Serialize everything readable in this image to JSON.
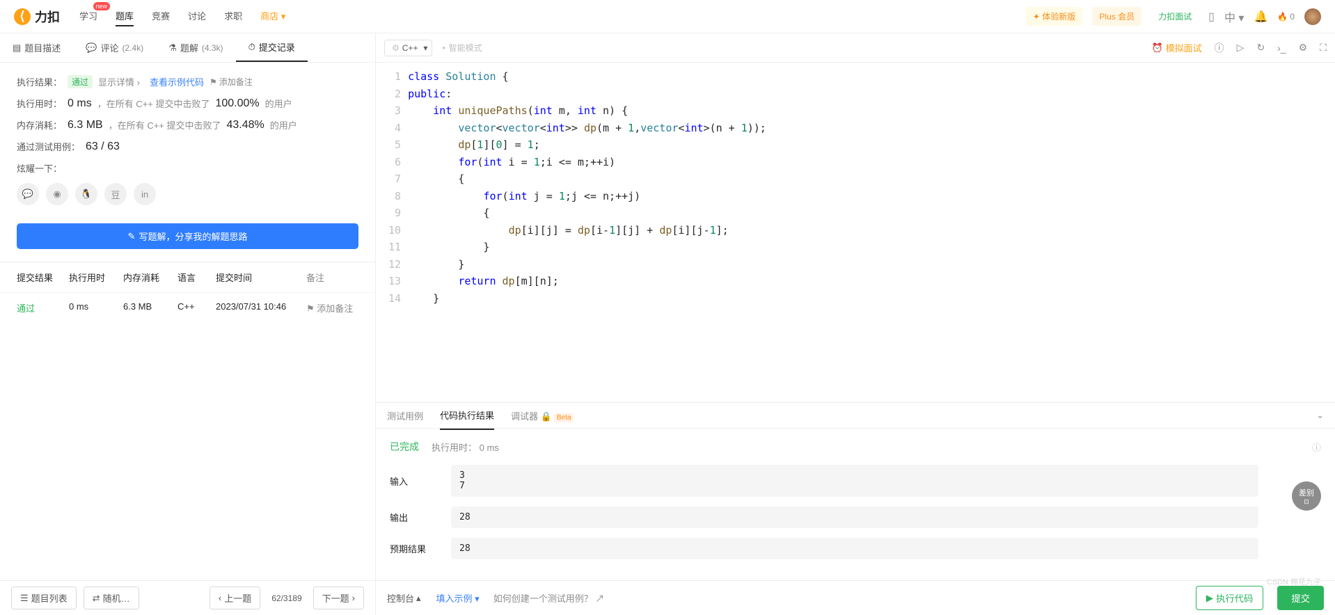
{
  "logo": "力扣",
  "nav": {
    "items": [
      "学习",
      "题库",
      "竞赛",
      "讨论",
      "求职",
      "商店"
    ],
    "badge_new": "new",
    "active_index": 1
  },
  "nav_right": {
    "try_new": "✦ 体验新版",
    "plus": "Plus 会员",
    "interview": "力扣面试",
    "lang": "中",
    "fire": "0"
  },
  "left_tabs": [
    {
      "icon": "▤",
      "label": "题目描述",
      "count": ""
    },
    {
      "icon": "💬",
      "label": "评论",
      "count": "(2.4k)"
    },
    {
      "icon": "⚗",
      "label": "题解",
      "count": "(4.3k)"
    },
    {
      "icon": "⏱",
      "label": "提交记录",
      "count": ""
    }
  ],
  "left_active_tab": 3,
  "result": {
    "exec_label": "执行结果：",
    "status": "通过",
    "show_detail": "显示详情",
    "view_example": "查看示例代码",
    "add_note": "添加备注",
    "runtime_label": "执行用时：",
    "runtime": "0 ms",
    "runtime_desc": "，在所有 C++ 提交中击败了",
    "runtime_pct": "100.00%",
    "runtime_users": "的用户",
    "memory_label": "内存消耗：",
    "memory": "6.3 MB",
    "memory_desc": "，在所有 C++ 提交中击败了",
    "memory_pct": "43.48%",
    "memory_users": "的用户",
    "testcase_label": "通过测试用例：",
    "testcase": "63 / 63",
    "share_label": "炫耀一下：",
    "write_solution": "写题解，分享我的解题思路"
  },
  "sub_table": {
    "headers": [
      "提交结果",
      "执行用时",
      "内存消耗",
      "语言",
      "提交时间",
      "备注"
    ],
    "rows": [
      {
        "result": "通过",
        "time": "0 ms",
        "mem": "6.3 MB",
        "lang": "C++",
        "date": "2023/07/31 10:46",
        "note": "添加备注"
      }
    ]
  },
  "code": {
    "lang": "C++",
    "smart_mode": "智能模式",
    "mock": "模拟面试"
  },
  "code_lines": [
    {
      "n": 1,
      "raw": "class Solution {"
    },
    {
      "n": 2,
      "raw": "public:"
    },
    {
      "n": 3,
      "raw": "    int uniquePaths(int m, int n) {"
    },
    {
      "n": 4,
      "raw": "        vector<vector<int>> dp(m + 1,vector<int>(n + 1));"
    },
    {
      "n": 5,
      "raw": "        dp[1][0] = 1;"
    },
    {
      "n": 6,
      "raw": "        for(int i = 1;i <= m;++i)"
    },
    {
      "n": 7,
      "raw": "        {"
    },
    {
      "n": 8,
      "raw": "            for(int j = 1;j <= n;++j)"
    },
    {
      "n": 9,
      "raw": "            {"
    },
    {
      "n": 10,
      "raw": "                dp[i][j] = dp[i-1][j] + dp[i][j-1];"
    },
    {
      "n": 11,
      "raw": "            }"
    },
    {
      "n": 12,
      "raw": "        }"
    },
    {
      "n": 13,
      "raw": "        return dp[m][n];"
    },
    {
      "n": 14,
      "raw": "    }"
    }
  ],
  "output_tabs": [
    "测试用例",
    "代码执行结果",
    "调试器"
  ],
  "output_active_tab": 1,
  "output": {
    "done": "已完成",
    "time_label": "执行用时：",
    "time": "0 ms",
    "input_label": "输入",
    "input": "3\n7",
    "output_label": "输出",
    "output_val": "28",
    "expected_label": "预期结果",
    "expected": "28",
    "beta": "Beta"
  },
  "bottom_left": {
    "list": "题目列表",
    "shuffle": "随机…",
    "prev": "上一题",
    "next": "下一题",
    "page": "62/3189"
  },
  "bottom_right": {
    "console": "控制台",
    "fill": "填入示例",
    "how": "如何创建一个测试用例？",
    "run": "执行代码",
    "submit": "提交"
  },
  "float_badge": "差别",
  "watermark": "CSDN 棉花九子"
}
